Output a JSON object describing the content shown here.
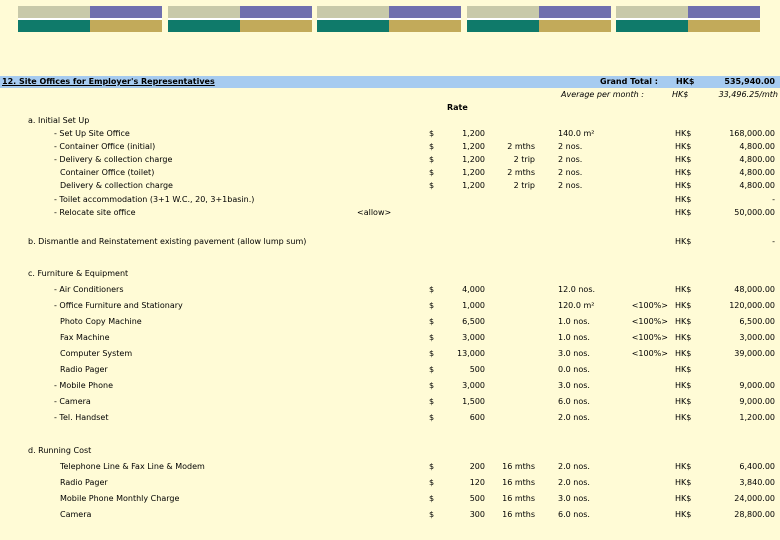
{
  "section": {
    "title": "12. Site Offices for Employer's Representatives",
    "grand_total_label": "Grand Total :",
    "grand_total_currency": "HK$",
    "grand_total_value": "535,940.00",
    "avg_label": "Average per month :",
    "avg_currency": "HK$",
    "avg_value": "33,496.25/mth",
    "rate_header": "Rate"
  },
  "groups": [
    {
      "heading": "a. Initial Set Up",
      "rows": [
        {
          "label": "- Set Up Site Office",
          "dollar": "$",
          "rate": "1,200",
          "duration": "",
          "qty": "140.0 m²",
          "pct": "",
          "cur": "HK$",
          "amount": "168,000.00"
        },
        {
          "label": "- Container Office (initial)",
          "dollar": "$",
          "rate": "1,200",
          "duration": "2 mths",
          "qty": "2 nos.",
          "pct": "",
          "cur": "HK$",
          "amount": "4,800.00"
        },
        {
          "label": "- Delivery & collection charge",
          "dollar": "$",
          "rate": "1,200",
          "duration": "2 trip",
          "qty": "2 nos.",
          "pct": "",
          "cur": "HK$",
          "amount": "4,800.00"
        },
        {
          "label": "Container Office (toilet)",
          "dollar": "$",
          "rate": "1,200",
          "duration": "2 mths",
          "qty": "2 nos.",
          "pct": "",
          "cur": "HK$",
          "amount": "4,800.00"
        },
        {
          "label": "Delivery & collection charge",
          "dollar": "$",
          "rate": "1,200",
          "duration": "2 trip",
          "qty": "2 nos.",
          "pct": "",
          "cur": "HK$",
          "amount": "4,800.00"
        },
        {
          "label": "- Toilet accommodation (3+1 W.C., 20, 3+1basin.)",
          "dollar": "",
          "rate": "",
          "duration": "",
          "qty": "",
          "pct": "",
          "cur": "HK$",
          "amount": "-"
        },
        {
          "label": "- Relocate site office",
          "allow": "<allow>",
          "dollar": "",
          "rate": "",
          "duration": "",
          "qty": "",
          "pct": "",
          "cur": "HK$",
          "amount": "50,000.00"
        }
      ]
    },
    {
      "heading": "b. Dismantle and Reinstatement existing pavement (allow lump sum)",
      "rows": [],
      "cur": "HK$",
      "amount": "-"
    },
    {
      "heading": "c. Furniture & Equipment",
      "rows": [
        {
          "label": "- Air Conditioners",
          "dollar": "$",
          "rate": "4,000",
          "duration": "",
          "qty": "12.0 nos.",
          "pct": "",
          "cur": "HK$",
          "amount": "48,000.00"
        },
        {
          "label": "- Office Furniture and Stationary",
          "dollar": "$",
          "rate": "1,000",
          "duration": "",
          "qty": "120.0 m²",
          "pct": "<100%>",
          "cur": "HK$",
          "amount": "120,000.00"
        },
        {
          "label": "Photo Copy Machine",
          "dollar": "$",
          "rate": "6,500",
          "duration": "",
          "qty": "1.0 nos.",
          "pct": "<100%>",
          "cur": "HK$",
          "amount": "6,500.00"
        },
        {
          "label": "Fax Machine",
          "dollar": "$",
          "rate": "3,000",
          "duration": "",
          "qty": "1.0 nos.",
          "pct": "<100%>",
          "cur": "HK$",
          "amount": "3,000.00"
        },
        {
          "label": "Computer System",
          "dollar": "$",
          "rate": "13,000",
          "duration": "",
          "qty": "3.0 nos.",
          "pct": "<100%>",
          "cur": "HK$",
          "amount": "39,000.00"
        },
        {
          "label": "Radio Pager",
          "dollar": "$",
          "rate": "500",
          "duration": "",
          "qty": "0.0 nos.",
          "pct": "",
          "cur": "HK$",
          "amount": ""
        },
        {
          "label": "- Mobile Phone",
          "dollar": "$",
          "rate": "3,000",
          "duration": "",
          "qty": "3.0 nos.",
          "pct": "",
          "cur": "HK$",
          "amount": "9,000.00"
        },
        {
          "label": "- Camera",
          "dollar": "$",
          "rate": "1,500",
          "duration": "",
          "qty": "6.0 nos.",
          "pct": "",
          "cur": "HK$",
          "amount": "9,000.00"
        },
        {
          "label": "- Tel. Handset",
          "dollar": "$",
          "rate": "600",
          "duration": "",
          "qty": "2.0 nos.",
          "pct": "",
          "cur": "HK$",
          "amount": "1,200.00"
        }
      ]
    },
    {
      "heading": "d. Running Cost",
      "rows": [
        {
          "label": "Telephone Line & Fax Line & Modem",
          "dollar": "$",
          "rate": "200",
          "duration": "16 mths",
          "qty": "2.0 nos.",
          "pct": "",
          "cur": "HK$",
          "amount": "6,400.00"
        },
        {
          "label": "Radio Pager",
          "dollar": "$",
          "rate": "120",
          "duration": "16 mths",
          "qty": "2.0 nos.",
          "pct": "",
          "cur": "HK$",
          "amount": "3,840.00"
        },
        {
          "label": "Mobile Phone Monthly Charge",
          "dollar": "$",
          "rate": "500",
          "duration": "16 mths",
          "qty": "3.0 nos.",
          "pct": "",
          "cur": "HK$",
          "amount": "24,000.00"
        },
        {
          "label": "Camera",
          "dollar": "$",
          "rate": "300",
          "duration": "16 mths",
          "qty": "6.0 nos.",
          "pct": "",
          "cur": "HK$",
          "amount": "28,800.00"
        }
      ]
    }
  ]
}
